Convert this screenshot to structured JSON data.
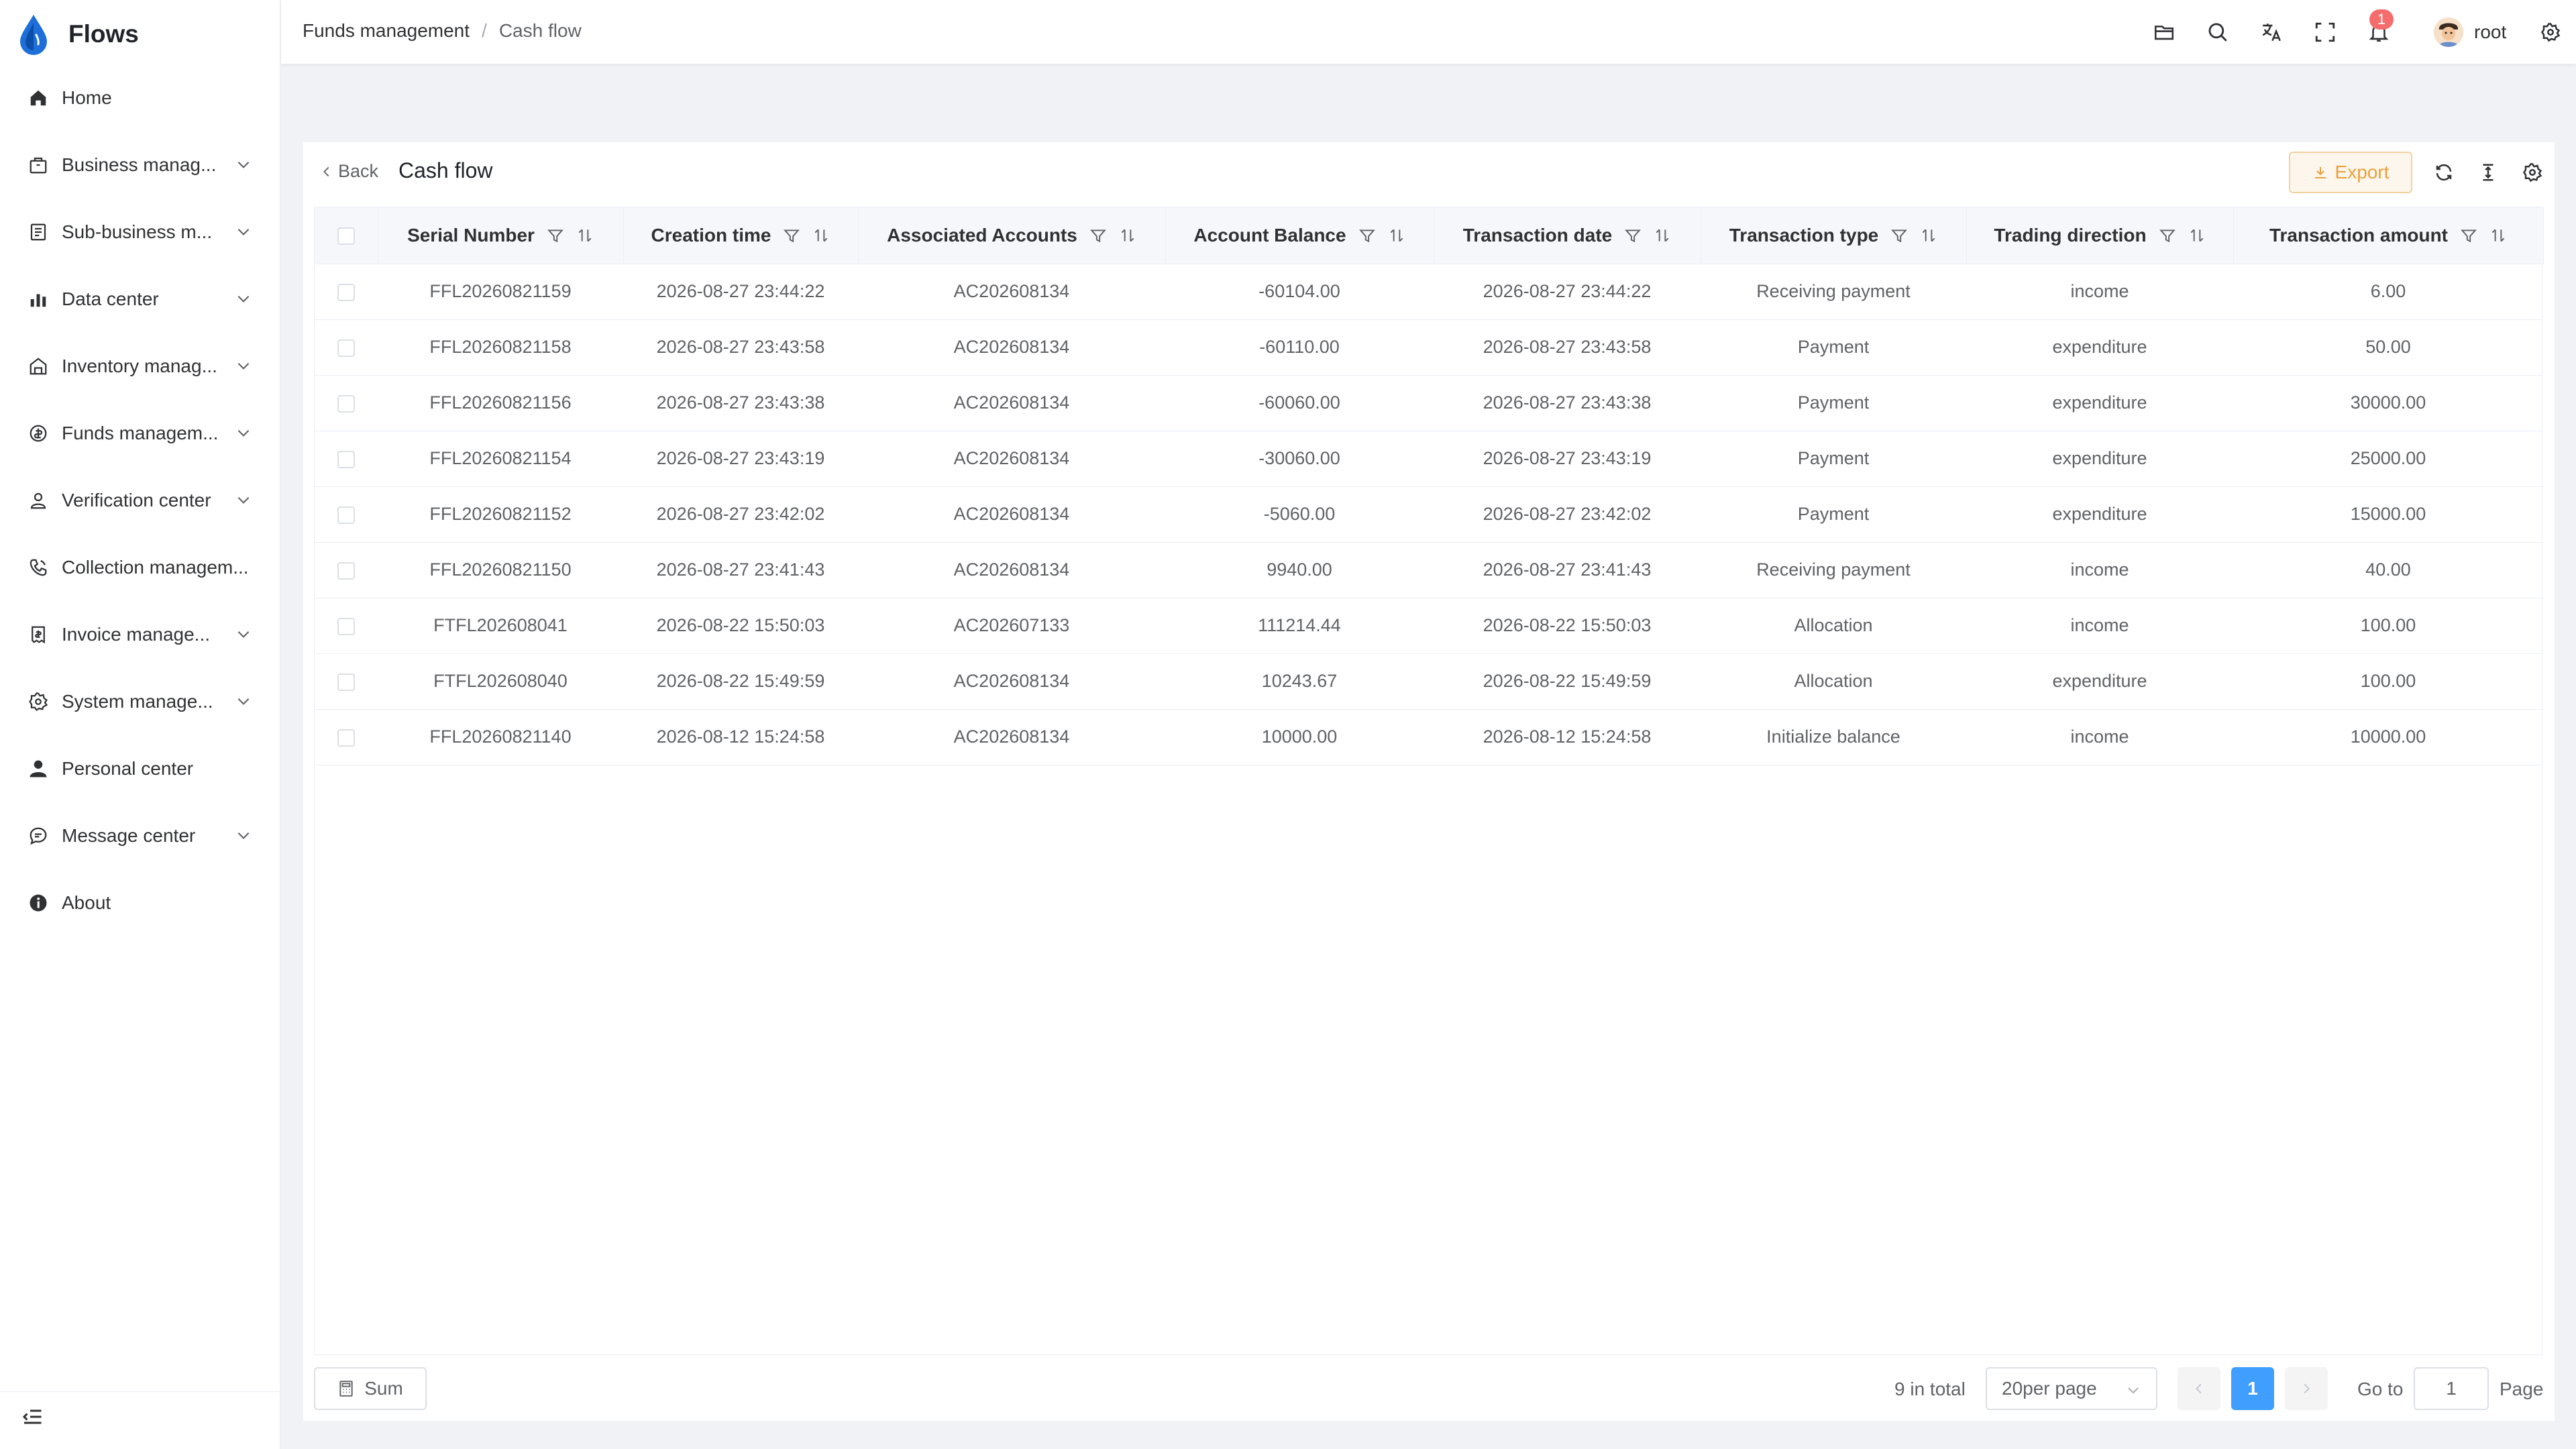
{
  "app": {
    "name": "Flows",
    "colors": {
      "primary": "#409eff",
      "warning": "#e6a23c",
      "danger": "#f56c6c"
    }
  },
  "sidebar": {
    "items": [
      {
        "label": "Home",
        "icon": "home-icon",
        "expandable": false
      },
      {
        "label": "Business manag...",
        "icon": "briefcase-icon",
        "expandable": true
      },
      {
        "label": "Sub-business m...",
        "icon": "document-icon",
        "expandable": true
      },
      {
        "label": "Data center",
        "icon": "bar-chart-icon",
        "expandable": true
      },
      {
        "label": "Inventory manag...",
        "icon": "warehouse-icon",
        "expandable": true
      },
      {
        "label": "Funds managem...",
        "icon": "coin-icon",
        "expandable": true
      },
      {
        "label": "Verification center",
        "icon": "user-check-icon",
        "expandable": true
      },
      {
        "label": "Collection managem...",
        "icon": "phone-icon",
        "expandable": false
      },
      {
        "label": "Invoice manage...",
        "icon": "invoice-icon",
        "expandable": true
      },
      {
        "label": "System manage...",
        "icon": "gear-icon",
        "expandable": true
      },
      {
        "label": "Personal center",
        "icon": "user-icon",
        "expandable": false
      },
      {
        "label": "Message center",
        "icon": "chat-icon",
        "expandable": true
      },
      {
        "label": "About",
        "icon": "info-icon",
        "expandable": false
      }
    ]
  },
  "header": {
    "breadcrumb": [
      "Funds management",
      "Cash flow"
    ],
    "breadcrumb_sep": "/",
    "notification_count": "1",
    "username": "root"
  },
  "page": {
    "back_label": "Back",
    "title": "Cash flow",
    "export_label": "Export"
  },
  "table": {
    "columns": [
      "Serial Number",
      "Creation time",
      "Associated Accounts",
      "Account Balance",
      "Transaction date",
      "Transaction type",
      "Trading direction",
      "Transaction amount"
    ],
    "rows": [
      [
        "FFL20260821159",
        "2026-08-27 23:44:22",
        "AC202608134",
        "-60104.00",
        "2026-08-27 23:44:22",
        "Receiving payment",
        "income",
        "6.00"
      ],
      [
        "FFL20260821158",
        "2026-08-27 23:43:58",
        "AC202608134",
        "-60110.00",
        "2026-08-27 23:43:58",
        "Payment",
        "expenditure",
        "50.00"
      ],
      [
        "FFL20260821156",
        "2026-08-27 23:43:38",
        "AC202608134",
        "-60060.00",
        "2026-08-27 23:43:38",
        "Payment",
        "expenditure",
        "30000.00"
      ],
      [
        "FFL20260821154",
        "2026-08-27 23:43:19",
        "AC202608134",
        "-30060.00",
        "2026-08-27 23:43:19",
        "Payment",
        "expenditure",
        "25000.00"
      ],
      [
        "FFL20260821152",
        "2026-08-27 23:42:02",
        "AC202608134",
        "-5060.00",
        "2026-08-27 23:42:02",
        "Payment",
        "expenditure",
        "15000.00"
      ],
      [
        "FFL20260821150",
        "2026-08-27 23:41:43",
        "AC202608134",
        "9940.00",
        "2026-08-27 23:41:43",
        "Receiving payment",
        "income",
        "40.00"
      ],
      [
        "FTFL202608041",
        "2026-08-22 15:50:03",
        "AC202607133",
        "111214.44",
        "2026-08-22 15:50:03",
        "Allocation",
        "income",
        "100.00"
      ],
      [
        "FTFL202608040",
        "2026-08-22 15:49:59",
        "AC202608134",
        "10243.67",
        "2026-08-22 15:49:59",
        "Allocation",
        "expenditure",
        "100.00"
      ],
      [
        "FFL20260821140",
        "2026-08-12 15:24:58",
        "AC202608134",
        "10000.00",
        "2026-08-12 15:24:58",
        "Initialize balance",
        "income",
        "10000.00"
      ]
    ]
  },
  "footer": {
    "sum_label": "Sum",
    "total_label": "9 in total",
    "per_page_label": "20per page",
    "current_page": "1",
    "goto_label": "Go to",
    "goto_value": "1",
    "page_label": "Page"
  }
}
